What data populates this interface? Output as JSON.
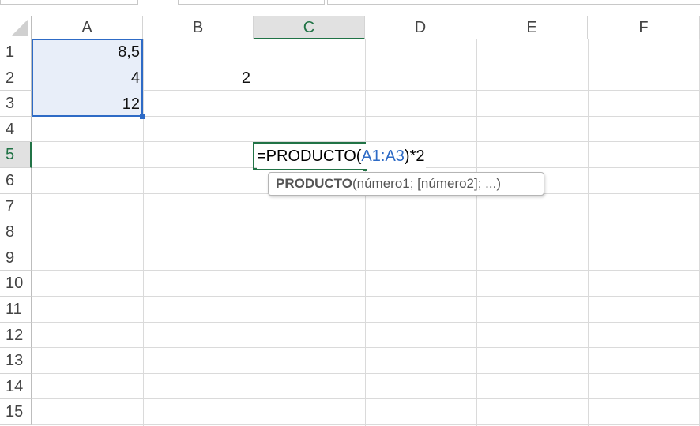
{
  "columns": [
    "A",
    "B",
    "C",
    "D",
    "E",
    "F"
  ],
  "rows": [
    "1",
    "2",
    "3",
    "4",
    "5",
    "6",
    "7",
    "8",
    "9",
    "10",
    "11",
    "12",
    "13",
    "14",
    "15"
  ],
  "cells": {
    "A1": "8,5",
    "A2": "4",
    "A3": "12",
    "B2": "2"
  },
  "active_cell": {
    "formula_prefix": "=PRODUCTO(",
    "formula_ref": "A1:A3",
    "formula_suffix": ")*2"
  },
  "tooltip": {
    "function": "PRODUCTO",
    "args": "(número1; [número2]; ...)"
  },
  "colors": {
    "accent": "#217346",
    "range": "#2e6bc6",
    "range_fill": "#e8eef9"
  }
}
